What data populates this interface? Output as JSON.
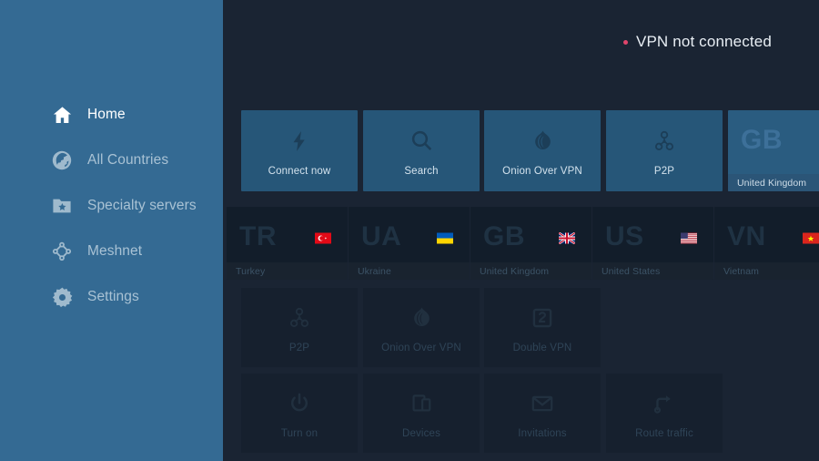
{
  "sidebar": {
    "items": [
      {
        "label": "Home",
        "icon": "home-icon",
        "state": "active"
      },
      {
        "label": "All Countries",
        "icon": "globe-icon",
        "state": "dim"
      },
      {
        "label": "Specialty servers",
        "icon": "folder-star-icon",
        "state": "dim"
      },
      {
        "label": "Meshnet",
        "icon": "meshnet-icon",
        "state": "dim"
      },
      {
        "label": "Settings",
        "icon": "gear-icon",
        "state": "dim"
      }
    ]
  },
  "status": {
    "text": "VPN not connected",
    "dot_color": "#e0456b"
  },
  "quick_actions": [
    {
      "label": "Connect now",
      "icon": "lightning-icon"
    },
    {
      "label": "Search",
      "icon": "search-icon"
    },
    {
      "label": "Onion Over VPN",
      "icon": "onion-icon"
    },
    {
      "label": "P2P",
      "icon": "p2p-icon"
    }
  ],
  "countries": [
    {
      "code": "TR",
      "name": "Turkey",
      "flag": "turkey-flag"
    },
    {
      "code": "UA",
      "name": "Ukraine",
      "flag": "ukraine-flag"
    },
    {
      "code": "GB",
      "name": "United Kingdom",
      "flag": "uk-flag"
    },
    {
      "code": "US",
      "name": "United States",
      "flag": "usa-flag"
    },
    {
      "code": "VN",
      "name": "Vietnam",
      "flag": "vietnam-flag"
    }
  ],
  "featured_country": {
    "code": "GB",
    "name": "United Kingdom"
  },
  "specialty_servers": [
    {
      "label": "P2P",
      "icon": "p2p-icon"
    },
    {
      "label": "Onion Over VPN",
      "icon": "onion-icon"
    },
    {
      "label": "Double VPN",
      "icon": "double-vpn-icon"
    }
  ],
  "meshnet_actions": [
    {
      "label": "Turn on",
      "icon": "power-icon"
    },
    {
      "label": "Devices",
      "icon": "devices-icon"
    },
    {
      "label": "Invitations",
      "icon": "envelope-icon"
    },
    {
      "label": "Route traffic",
      "icon": "route-icon"
    }
  ],
  "theme": {
    "sidebar_bg": "#346a93",
    "main_bg": "#1a2433",
    "tile_bright": "#265678",
    "tile_dim": "#16202e",
    "accent_red": "#e0456b"
  }
}
